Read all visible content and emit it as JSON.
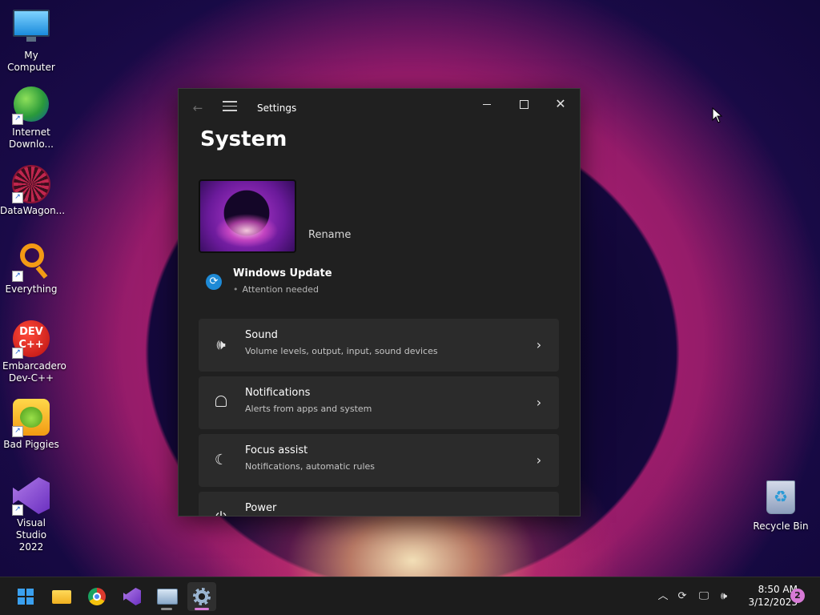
{
  "desktop": {
    "icons": [
      {
        "label": "My Computer",
        "icon": "computer-icon"
      },
      {
        "label": "Internet Downlo...",
        "icon": "idm-icon"
      },
      {
        "label": "DataWagon...",
        "icon": "datawagon-icon"
      },
      {
        "label": "Everything",
        "icon": "everything-icon"
      },
      {
        "label": "Embarcadero Dev-C++",
        "icon": "devcpp-icon",
        "glyph": "DEV C++"
      },
      {
        "label": "Bad Piggies",
        "icon": "bad-piggies-icon"
      },
      {
        "label": "Visual Studio 2022",
        "icon": "visual-studio-icon"
      },
      {
        "label": "Recycle Bin",
        "icon": "recycle-bin-icon"
      }
    ]
  },
  "window": {
    "app_title": "Settings",
    "page_title": "System",
    "rename_label": "Rename",
    "windows_update": {
      "title": "Windows Update",
      "status": "Attention needed"
    },
    "cards": [
      {
        "title": "Sound",
        "subtitle": "Volume levels, output, input, sound devices",
        "icon": "speaker-icon"
      },
      {
        "title": "Notifications",
        "subtitle": "Alerts from apps and system",
        "icon": "bell-icon"
      },
      {
        "title": "Focus assist",
        "subtitle": "Notifications, automatic rules",
        "icon": "moon-icon"
      },
      {
        "title": "Power",
        "subtitle": "",
        "icon": "power-icon"
      }
    ]
  },
  "taskbar": {
    "apps": [
      "start-icon",
      "file-explorer-icon",
      "chrome-icon",
      "visual-studio-icon",
      "remote-desktop-icon",
      "settings-icon"
    ],
    "time": "8:50 AM",
    "date": "3/12/2023",
    "notification_count": "2"
  },
  "colors": {
    "window_bg": "#202020",
    "card_bg": "#2b2b2b",
    "accent": "#d77ad6",
    "update_blue": "#1e8ad6"
  }
}
